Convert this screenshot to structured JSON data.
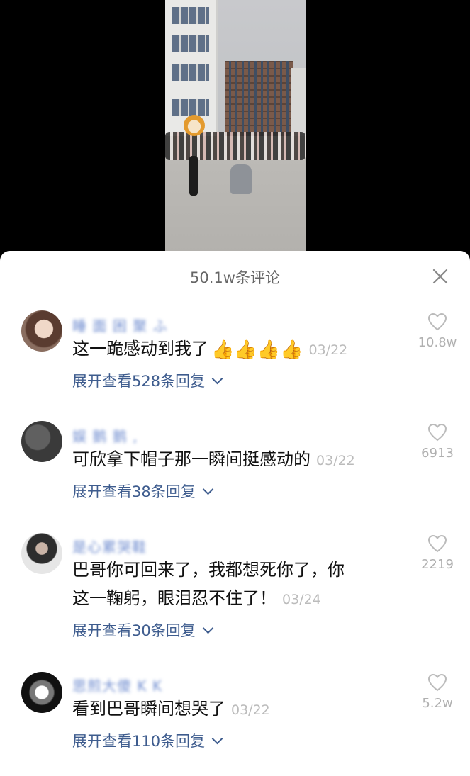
{
  "header": {
    "title": "50.1w条评论"
  },
  "comments": [
    {
      "username": "睡 面 困 聚 ふ",
      "text": "这一跪感动到我了",
      "emoji": "👍👍👍👍",
      "date": "03/22",
      "expand": "展开查看528条回复",
      "likes": "10.8w"
    },
    {
      "username": "娱 鹅 鹅 ,",
      "text": "可欣拿下帽子那一瞬间挺感动的",
      "date": "03/22",
      "expand": "展开查看38条回复",
      "likes": "6913"
    },
    {
      "username": "是心累哭鞋",
      "text_line1": "巴哥你可回来了，我都想死你了，你",
      "text_line2": "这一鞠躬，眼泪忍不住了！",
      "date": "03/24",
      "expand": "展开查看30条回复",
      "likes": "2219"
    },
    {
      "username": "思煎大傻 K K",
      "text": "看到巴哥瞬间想哭了",
      "date": "03/22",
      "expand": "展开查看110条回复",
      "likes": "5.2w"
    }
  ]
}
